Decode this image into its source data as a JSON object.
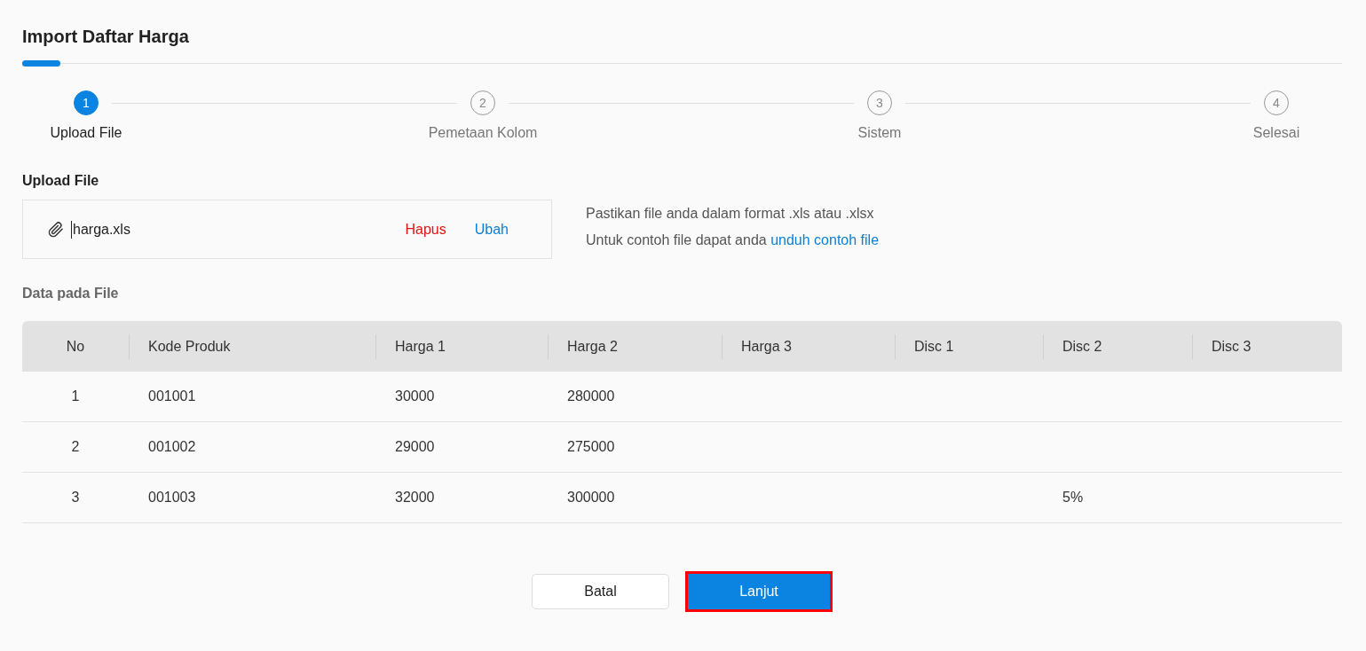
{
  "page": {
    "title": "Import Daftar Harga"
  },
  "steps": [
    {
      "number": "1",
      "label": "Upload File",
      "selected": true
    },
    {
      "number": "2",
      "label": "Pemetaan Kolom",
      "selected": false
    },
    {
      "number": "3",
      "label": "Sistem",
      "selected": false
    },
    {
      "number": "4",
      "label": "Selesai",
      "selected": false
    }
  ],
  "upload": {
    "heading": "Upload File",
    "file_name": "harga.xls",
    "remove": "Hapus",
    "change": "Ubah",
    "info_line_1": "Pastikan file anda dalam format .xls atau .xlsx",
    "info_line_2": "Untuk contoh file dapat anda",
    "info_link": "unduh contoh file"
  },
  "table": {
    "heading": "Data pada File",
    "columns": [
      "No",
      "Kode Produk",
      "Harga 1",
      "Harga 2",
      "Harga 3",
      "Disc 1",
      "Disc 2",
      "Disc 3"
    ],
    "rows": [
      [
        "1",
        "001001",
        "30000",
        "280000",
        null,
        null,
        null,
        null
      ],
      [
        "2",
        "001002",
        "29000",
        "275000",
        null,
        null,
        null,
        null
      ],
      [
        "3",
        "001003",
        "32000",
        "300000",
        null,
        null,
        "5%",
        null
      ]
    ]
  },
  "buttons": [
    {
      "kind": "secondary",
      "label": "Batal",
      "highlighted": false
    },
    {
      "kind": "primary",
      "label": "Lanjut",
      "highlighted": true
    }
  ]
}
